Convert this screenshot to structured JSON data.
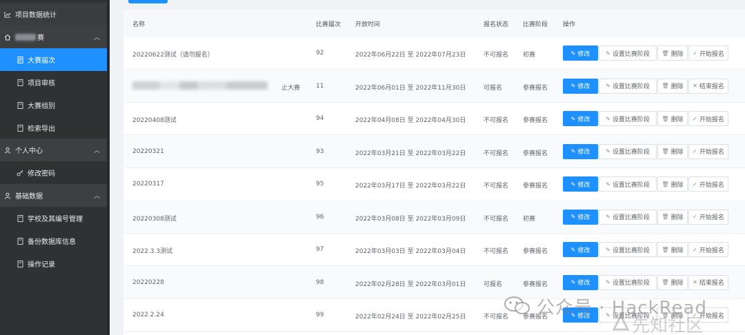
{
  "sidebar": {
    "top_item": {
      "label": "项目数据统计"
    },
    "groups": [
      {
        "label": "赛",
        "items": [
          {
            "label": "大赛届次",
            "active": true
          },
          {
            "label": "项目审核"
          },
          {
            "label": "大赛组别"
          },
          {
            "label": "检索导出"
          }
        ]
      },
      {
        "label": "个人中心",
        "items": [
          {
            "label": "修改密码"
          }
        ]
      },
      {
        "label": "基础数据",
        "items": [
          {
            "label": "学校及其编号管理"
          },
          {
            "label": "备份数据库信息"
          },
          {
            "label": "操作记录"
          }
        ]
      }
    ]
  },
  "table": {
    "columns": {
      "name": "名称",
      "session": "比赛届次",
      "open_time": "开放时间",
      "signup_status": "报名状态",
      "stage": "比赛阶段",
      "ops": "操作"
    },
    "buttons": {
      "edit": "修改",
      "set_stage": "设置比赛阶段",
      "delete": "删除",
      "start_signup": "开始报名",
      "end_signup": "结束报名"
    },
    "rows": [
      {
        "name": "20220622测试（请勿报名）",
        "session": "92",
        "time": "2022年06月22日 至 2022年07月23日",
        "status": "不可报名",
        "stage": "初赛",
        "signup_action": "开始报名"
      },
      {
        "name": "止大赛",
        "name_blurred": true,
        "session": "11",
        "time": "2022年06月01日 至 2022年11月30日",
        "status": "可报名",
        "stage": "参赛报名",
        "signup_action": "结束报名"
      },
      {
        "name": "20220408测试",
        "session": "94",
        "time": "2022年04月08日 至 2022年04月30日",
        "status": "不可报名",
        "stage": "参赛报名",
        "signup_action": "开始报名"
      },
      {
        "name": "20220321",
        "session": "93",
        "time": "2022年03月21日 至 2022年03月22日",
        "status": "不可报名",
        "stage": "参赛报名",
        "signup_action": "开始报名"
      },
      {
        "name": "20220317",
        "session": "95",
        "time": "2022年03月17日 至 2022年03月22日",
        "status": "不可报名",
        "stage": "参赛报名",
        "signup_action": "开始报名"
      },
      {
        "name": "20220308测试",
        "session": "96",
        "time": "2022年03月08日 至 2022年03月09日",
        "status": "不可报名",
        "stage": "初赛",
        "signup_action": "开始报名"
      },
      {
        "name": "2022.3.3测试",
        "session": "97",
        "time": "2022年03月03日 至 2022年03月04日",
        "status": "不可报名",
        "stage": "参赛报名",
        "signup_action": "开始报名"
      },
      {
        "name": "20220228",
        "session": "98",
        "time": "2022年02月28日 至 2022年03月01日",
        "status": "可报名",
        "stage": "参赛报名",
        "signup_action": "结束报名"
      },
      {
        "name": "2022.2.24",
        "session": "99",
        "time": "2022年02月24日 至 2022年02月25日",
        "status": "不可报名",
        "stage": "参赛报名",
        "signup_action": "开始报名"
      }
    ]
  },
  "watermark": {
    "line1": "公众号 · HackRead",
    "line2": "先知社区"
  }
}
